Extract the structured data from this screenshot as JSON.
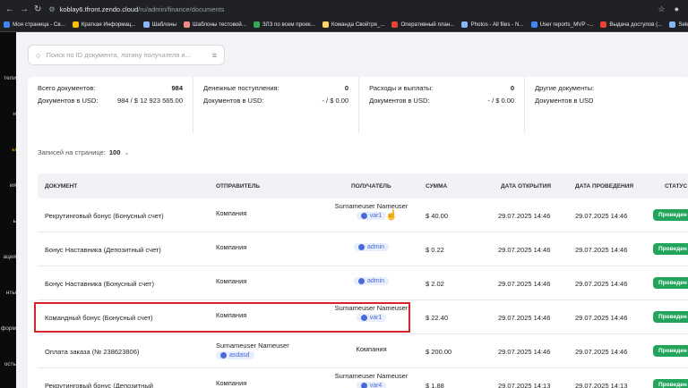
{
  "browser": {
    "host": "koblay6.tfront.zendo.cloud",
    "path": "/ru/admin/finance/documents"
  },
  "bookmarks": [
    {
      "label": "Моя страница - Св...",
      "color": "#4285f4"
    },
    {
      "label": "Краткая Информац...",
      "color": "#fbbc04"
    },
    {
      "label": "Шаблоны",
      "color": "#8ab4f8"
    },
    {
      "label": "Шаблоны тестовой...",
      "color": "#f28b82"
    },
    {
      "label": "ЗЛЗ по всем проек...",
      "color": "#34a853"
    },
    {
      "label": "Команда Свойтря_...",
      "color": "#fdd663"
    },
    {
      "label": "Оперативный план...",
      "color": "#ea4335"
    },
    {
      "label": "Photos - All files - N...",
      "color": "#8ab4f8"
    },
    {
      "label": "User reports_MVP -...",
      "color": "#4285f4"
    },
    {
      "label": "Выдача доступов (...",
      "color": "#ea4335"
    },
    {
      "label": "Select user_closure...",
      "color": "#8ab4f8"
    }
  ],
  "sidebar": [
    "тели",
    "н",
    "ы",
    "ия",
    "ь",
    "ация",
    "нты",
    "форм",
    "ость"
  ],
  "search": {
    "placeholder": "Поиск по ID документа, логину получателя и..."
  },
  "stats": [
    {
      "l1": "Всего документов:",
      "v1": "984",
      "l2": "Документов в USD:",
      "v2": "984 / $ 12 923 565.00"
    },
    {
      "l1": "Денежные поступления:",
      "v1": "0",
      "l2": "Документов в USD:",
      "v2": "- / $ 0.00"
    },
    {
      "l1": "Расходы и выплаты:",
      "v1": "0",
      "l2": "Документов в USD:",
      "v2": "- / $ 0.00"
    },
    {
      "l1": "Другие документы:",
      "v1": "",
      "l2": "Документов в USD",
      "v2": ""
    }
  ],
  "per_page": {
    "label": "Записей на странице:",
    "value": "100"
  },
  "columns": [
    "ДОКУМЕНТ",
    "ОТПРАВИТЕЛЬ",
    "ПОЛУЧАТЕЛЬ",
    "СУММА",
    "ДАТА ОТКРЫТИЯ",
    "ДАТА ПРОВЕДЕНИЯ",
    "СТАТУС"
  ],
  "rows": [
    {
      "doc": "Рекрутинговый бонус (Бонусный счет)",
      "sender_name": "Компания",
      "sender_chip": "",
      "recipient_name": "Surnameuser Nameuser",
      "recipient_chip": "var1",
      "amount": "$ 40.00",
      "opened": "29.07.2025 14:46",
      "done": "29.07.2025 14:46",
      "status": "Проведен"
    },
    {
      "doc": "Бонус Наставника (Депозитный счет)",
      "sender_name": "Компания",
      "sender_chip": "",
      "recipient_name": "",
      "recipient_chip": "admin",
      "amount": "$ 0.22",
      "opened": "29.07.2025 14:46",
      "done": "29.07.2025 14:46",
      "status": "Проведен"
    },
    {
      "doc": "Бонус Наставника (Бонусный счет)",
      "sender_name": "Компания",
      "sender_chip": "",
      "recipient_name": "",
      "recipient_chip": "admin",
      "amount": "$ 2.02",
      "opened": "29.07.2025 14:46",
      "done": "29.07.2025 14:46",
      "status": "Проведен"
    },
    {
      "doc": "Командный бонус (Бонусный счет)",
      "sender_name": "Компания",
      "sender_chip": "",
      "recipient_name": "Surnameuser Nameuser",
      "recipient_chip": "var1",
      "amount": "$ 22.40",
      "opened": "29.07.2025 14:46",
      "done": "29.07.2025 14:46",
      "status": "Проведен"
    },
    {
      "doc": "Оплата заказа (№ 238623806)",
      "sender_name": "Surnameuser Nameuser",
      "sender_chip": "asdasd",
      "recipient_name": "Компания",
      "recipient_chip": "",
      "amount": "$ 200.00",
      "opened": "29.07.2025 14:46",
      "done": "29.07.2025 14:46",
      "status": "Проведен"
    },
    {
      "doc": "Рекрутинговый бонус (Депозитный",
      "sender_name": "Компания",
      "sender_chip": "",
      "recipient_name": "Surnameuser Nameuser",
      "recipient_chip": "var4",
      "amount": "$ 1.88",
      "opened": "29.07.2025 14:13",
      "done": "29.07.2025 14:13",
      "status": "Проведен"
    }
  ]
}
